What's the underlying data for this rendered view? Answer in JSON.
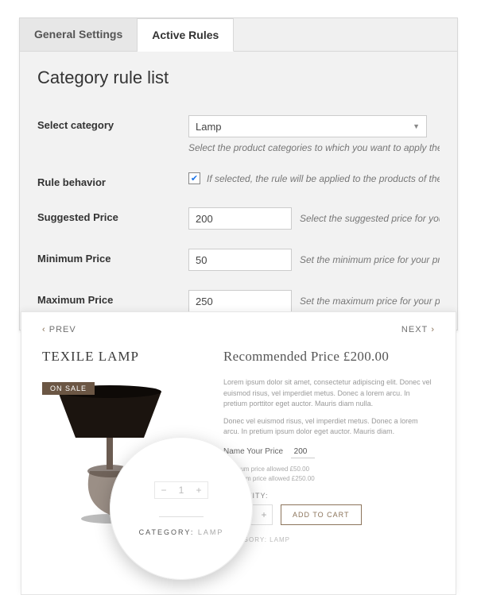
{
  "tabs": {
    "general": "General Settings",
    "active": "Active Rules"
  },
  "heading": "Category rule list",
  "select_category": {
    "label": "Select category",
    "value": "Lamp",
    "help": "Select the product categories to which you want to apply the rule"
  },
  "rule_behavior": {
    "label": "Rule behavior",
    "help": "If selected, the rule will be applied to the products of the select"
  },
  "suggested_price": {
    "label": "Suggested Price",
    "value": "200",
    "help": "Select the suggested price for your p"
  },
  "minimum_price": {
    "label": "Minimum Price",
    "value": "50",
    "help": "Set the minimum price for your pro"
  },
  "maximum_price": {
    "label": "Maximum Price",
    "value": "250",
    "help": "Set the maximum price for your pro"
  },
  "pager": {
    "prev": "PREV",
    "next": "NEXT"
  },
  "product": {
    "title": "TEXILE LAMP",
    "sale": "ON SALE",
    "recommended": "Recommended Price £200.00",
    "lorem1": "Lorem ipsum dolor sit amet, consectetur adipiscing elit. Donec vel euismod risus, vel imperdiet metus. Donec a lorem arcu. In pretium porttitor eget auctor. Mauris diam nulla.",
    "lorem2": "Donec vel euismod risus, vel imperdiet metus. Donec a lorem arcu. In pretium ipsum dolor eget auctor. Mauris diam.",
    "nyp_label": "Name Your Price",
    "nyp_value": "200",
    "min_note": "Minimum price allowed £50.00",
    "max_note": "Maximum price allowed £250.00",
    "qty_label": "QUANTITY:",
    "qty_value": "1",
    "add_cart": "ADD TO CART",
    "category_line": "CATEGORY: LAMP"
  },
  "magnifier": {
    "qty": "1",
    "cat_label": "CATEGORY:",
    "cat_value": "LAMP"
  }
}
